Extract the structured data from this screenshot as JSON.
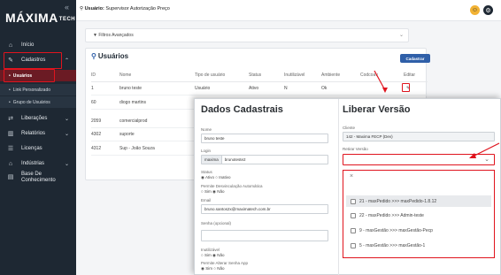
{
  "sidebar": {
    "logo": "MÁXIMA",
    "logo_suffix": "TECH",
    "collapse_glyph": "«",
    "items": [
      {
        "label": "Início",
        "icon": "home-icon",
        "glyph": "⌂"
      },
      {
        "label": "Cadastros",
        "icon": "edit-icon",
        "glyph": "✎",
        "chevron": "⌃"
      },
      {
        "label": "Liberações",
        "icon": "liberations-icon",
        "glyph": "⇄",
        "chevron": "⌄"
      },
      {
        "label": "Relatórios",
        "icon": "chart-icon",
        "glyph": "▥",
        "chevron": "⌄"
      },
      {
        "label": "Licenças",
        "icon": "license-icon",
        "glyph": "☰"
      },
      {
        "label": "Indústrias",
        "icon": "factory-icon",
        "glyph": "⌂",
        "chevron": "⌄"
      },
      {
        "label": "Base De Conhecimento",
        "icon": "book-icon",
        "glyph": "▤"
      }
    ],
    "subitems": [
      {
        "label": "Usuários"
      },
      {
        "label": "Link Personalizado"
      },
      {
        "label": "Grupo de Usuários"
      }
    ]
  },
  "topbar": {
    "user_label": "Usuário:",
    "user_name": "Supervisor Autorização Preço",
    "icons": [
      "support-icon",
      "settings-icon"
    ]
  },
  "filter": {
    "label": "Filtros Avançados"
  },
  "users": {
    "title": "Usuários",
    "add_button": "Cadastrar",
    "columns": [
      "ID",
      "Nome",
      "Tipo de usuário",
      "Status",
      "Inutilizável",
      "Ambiente",
      "Codcoav",
      "Editar"
    ],
    "rows": [
      [
        "1",
        "bruno teste",
        "Usuário",
        "Ativo",
        "N",
        "Ok",
        "",
        "✎"
      ],
      [
        "60",
        "diogo martins",
        "",
        "",
        "",
        "",
        "",
        ""
      ],
      [
        "2059",
        "comercialprod",
        "",
        "",
        "",
        "",
        "",
        ""
      ],
      [
        "4302",
        "suporte",
        "",
        "",
        "",
        "",
        "",
        ""
      ],
      [
        "4312",
        "Sup - João Souza",
        "",
        "",
        "",
        "",
        "",
        ""
      ]
    ]
  },
  "dados": {
    "title": "Dados Cadastrais",
    "nome_label": "Nome",
    "nome_value": "bruno teste",
    "login_label": "Login",
    "login_prefix": "maxima",
    "login_value": "brunoteste2",
    "status_label": "Status",
    "status_opt1": "Ativo",
    "status_opt2": "Inativo",
    "perm_label": "Permite Desvinculação Automática",
    "sim": "Sim",
    "nao": "Não",
    "email_label": "Email",
    "email_value": "bruno.santos2x@maximatech.com.br",
    "senha_label": "Senha (opcional)",
    "inutil_label": "Inutilizável",
    "alterar_label": "Permite Alterar Senha App"
  },
  "liberar": {
    "title": "Liberar Versão",
    "cliente_label": "Cliente",
    "cliente_value": "142 - Maxima FECP (Dev)",
    "retirar_label": "Retirar Versão",
    "dropdown_close": "×",
    "options": [
      "21 - maxPedido >>> maxPedido-1.8.12",
      "22 - maxPedido >>> Admin-teste",
      "9 - maxGestão >>> maxGestão-Pecp",
      "5 - maxGestão >>> maxGestão-1"
    ]
  },
  "colors": {
    "sidebar": "#1e2833",
    "active_sub": "#6b1b24",
    "accent": "#2f5fa8",
    "highlight": "#e0141e"
  }
}
